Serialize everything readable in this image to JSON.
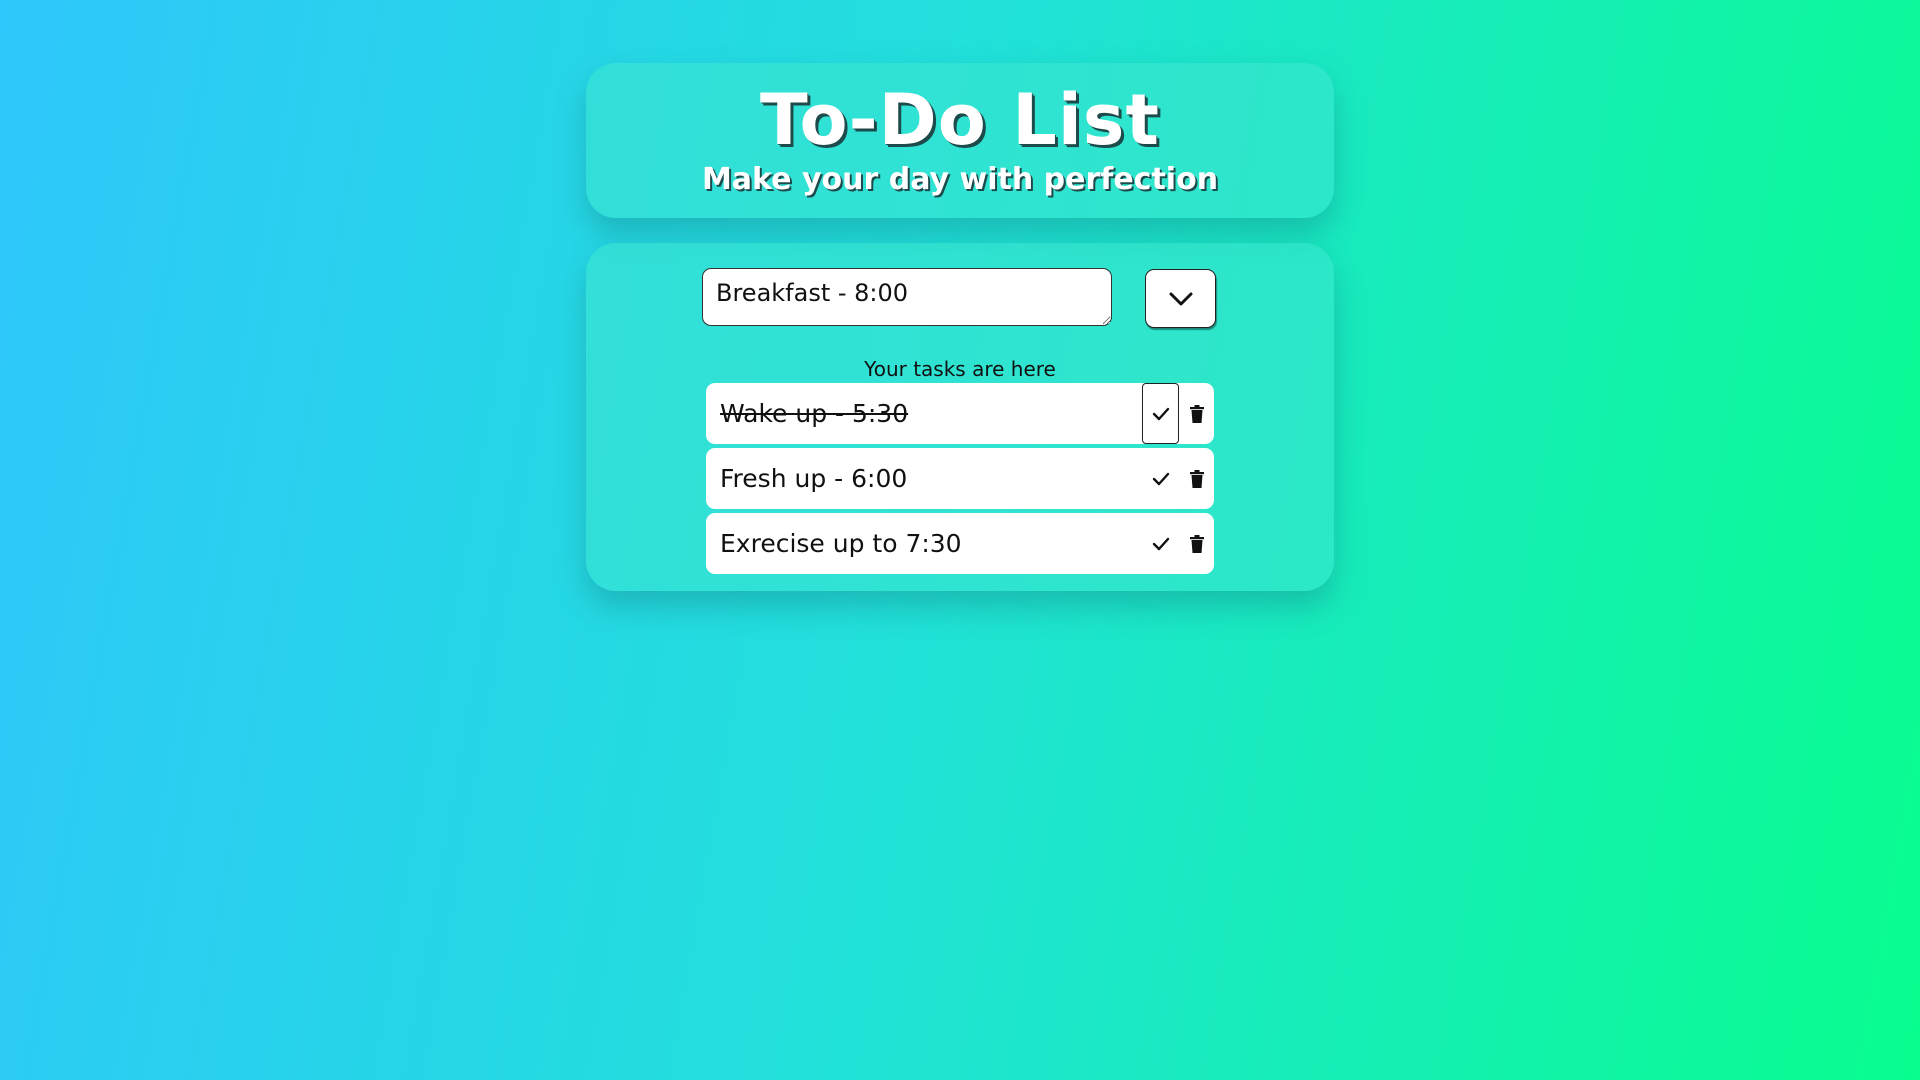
{
  "header": {
    "title": "To-Do List",
    "subtitle": "Make your day with perfection"
  },
  "input": {
    "value": "Breakfast - 8:00",
    "placeholder": ""
  },
  "add_button_icon": "chevron-down-icon",
  "list_caption": "Your tasks are here",
  "tasks": [
    {
      "text": "Wake up - 5:30",
      "completed": true
    },
    {
      "text": "Fresh up - 6:00",
      "completed": false
    },
    {
      "text": "Exrecise up to 7:30",
      "completed": false
    }
  ],
  "task_action_icons": [
    "check-icon",
    "trash-icon"
  ],
  "colors": {
    "gradient_start": "#2ec7fb",
    "gradient_end": "#08fd8e",
    "panel": "#3ce6cd"
  }
}
